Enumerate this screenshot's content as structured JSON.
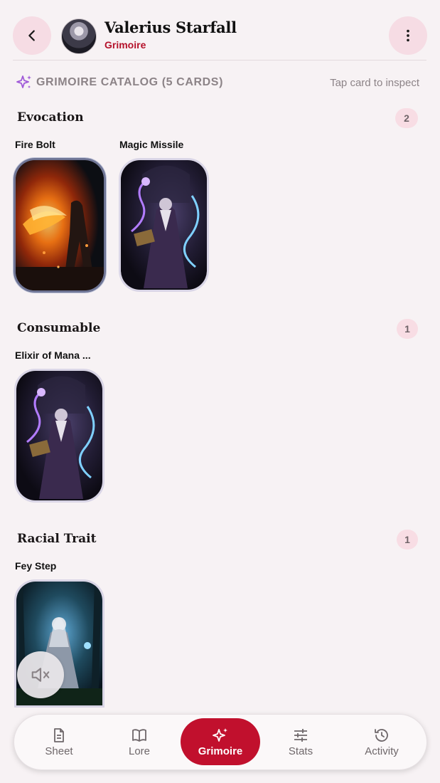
{
  "header": {
    "character_name": "Valerius Starfall",
    "subtitle": "Grimoire",
    "back_icon": "chevron-left-icon",
    "more_icon": "more-vertical-icon"
  },
  "catalog": {
    "title": "GRIMOIRE CATALOG (5 CARDS)",
    "hint": "Tap card to inspect",
    "icon": "sparkles-icon",
    "accent_color": "#a05ad8"
  },
  "sections": [
    {
      "title": "Evocation",
      "count": "2",
      "cards": [
        {
          "label": "Fire Bolt",
          "art": "fire-caster"
        },
        {
          "label": "Magic Missile",
          "art": "arcane-wizard"
        }
      ]
    },
    {
      "title": "Consumable",
      "count": "1",
      "cards": [
        {
          "label": "Elixir of Mana ...",
          "art": "arcane-wizard"
        }
      ]
    },
    {
      "title": "Racial Trait",
      "count": "1",
      "cards": [
        {
          "label": "Fey Step",
          "art": "forest-elf"
        }
      ]
    }
  ],
  "mute_icon": "volume-mute-icon",
  "nav": {
    "items": [
      {
        "label": "Sheet",
        "icon": "document-icon"
      },
      {
        "label": "Lore",
        "icon": "book-icon"
      },
      {
        "label": "Grimoire",
        "icon": "sparkles-icon",
        "active": true
      },
      {
        "label": "Stats",
        "icon": "sliders-icon"
      },
      {
        "label": "Activity",
        "icon": "history-icon"
      }
    ],
    "active_color": "#c1102d"
  }
}
